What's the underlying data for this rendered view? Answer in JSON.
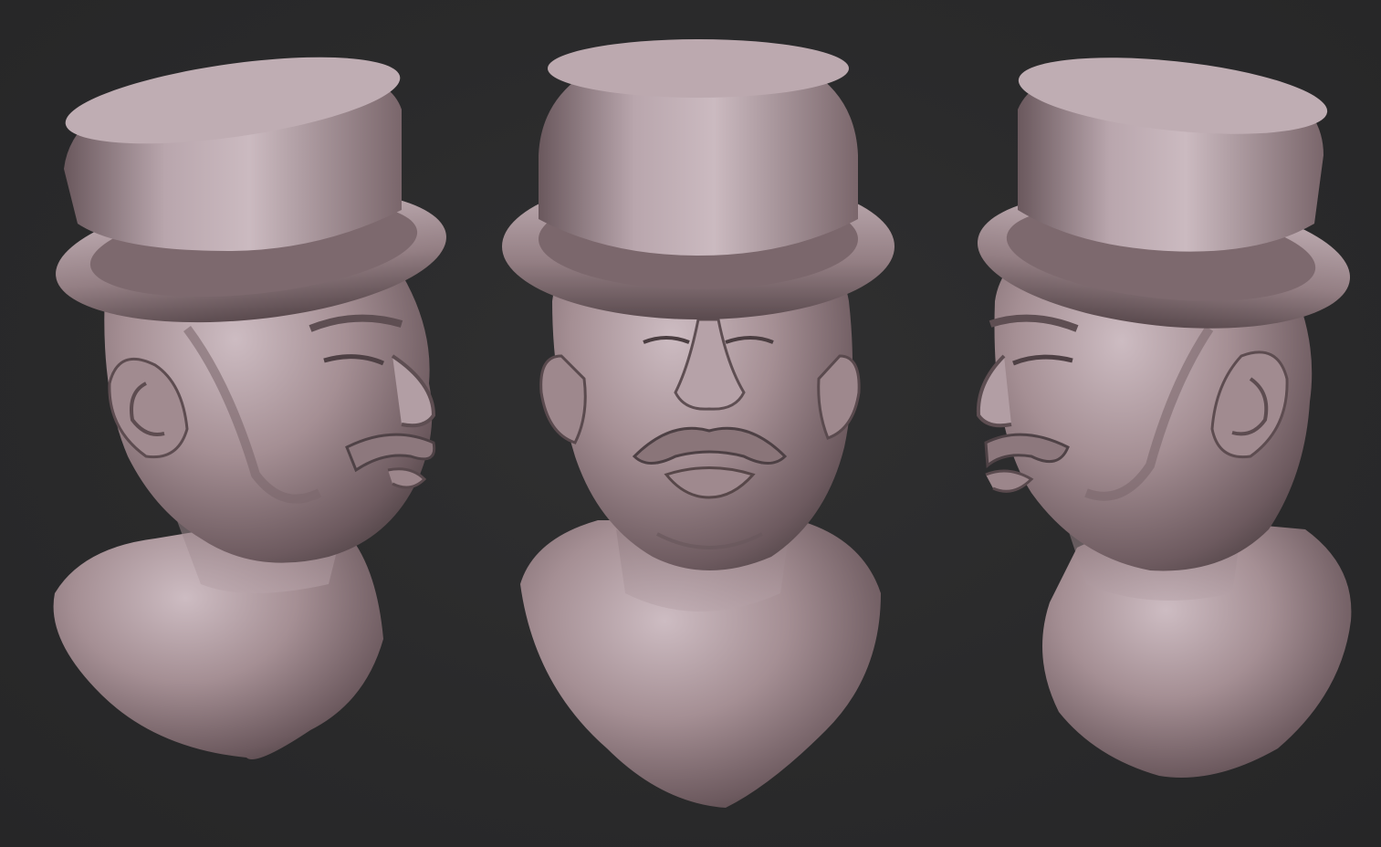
{
  "scene": {
    "background_color": "#2a2a2b",
    "material_color": "#9a8589",
    "material_highlight": "#c8b6bc",
    "material_shadow": "#5e4f53",
    "views": [
      {
        "id": "three-quarter-right",
        "subject": "bust-man-top-hat"
      },
      {
        "id": "front",
        "subject": "bust-man-top-hat"
      },
      {
        "id": "three-quarter-left",
        "subject": "bust-man-top-hat"
      }
    ]
  }
}
